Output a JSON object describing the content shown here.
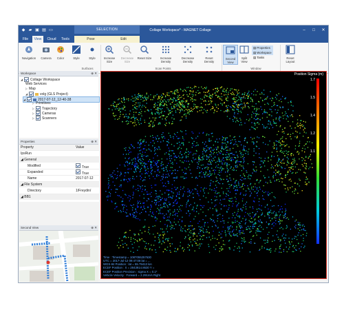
{
  "title_bar": {
    "context_tab_title": "SELECTION",
    "app_title": "Collage Workspace* - MAGNET Collage",
    "minimize_glyph": "–",
    "maximize_glyph": "□",
    "close_glyph": "✕"
  },
  "tabs": [
    "File",
    "View",
    "Cloud",
    "Tools",
    "Pose",
    "Edit"
  ],
  "active_tab": "View",
  "ribbon": {
    "buttons": {
      "navigation": "Navigation",
      "camera": "Camera",
      "color": "Color",
      "style1": "Style",
      "style2": "Style",
      "increase_size": "Increase Size",
      "decrease_size": "Decrease Size",
      "reset_size": "Reset Size",
      "increase_density": "Increase Density",
      "decrease_density": "Decrease Density",
      "reset_density": "Reset Density",
      "second_view": "Second View",
      "split_view": "Split View",
      "properties": "Properties",
      "workspace": "Workspace",
      "tasks": "Tasks",
      "reset_layout": "Reset Layout"
    },
    "groups": {
      "surfaces": "Surfaces",
      "scan_points": "Scan Points",
      "window": "Window"
    }
  },
  "workspace_panel": {
    "title": "Workspace",
    "items": {
      "root": "Collage Workspace",
      "web_services": "Web Services",
      "map": "Map",
      "project": "volg (GLS Project)",
      "run": "2017-07-12_12-40-38",
      "primitives": "Primitives",
      "trajectory": "Trajectory",
      "cameras": "Cameras",
      "scanners": "Scanners"
    }
  },
  "properties_panel": {
    "title": "Properties",
    "header_property": "Property",
    "header_value": "Value",
    "object": "IpsRun",
    "cat_general": "General",
    "rows": [
      {
        "k": "Modified",
        "v": "True"
      },
      {
        "k": "Expanded",
        "v": "True"
      },
      {
        "k": "Name",
        "v": "2017-07-12"
      }
    ],
    "cat_fs": "File System",
    "dir_k": "Directory",
    "dir_v": "1/Freydin/",
    "cat_bb": "BB1"
  },
  "second_view": {
    "title": "Second View"
  },
  "viewer": {
    "colorbar_title": "Position Sigma (m)",
    "colorbar_labels": [
      "1.7",
      "1.5",
      "1.4",
      "1.2",
      "1.1"
    ],
    "info_lines": [
      "Time : Timestamp = 1087055257630",
      "UTC = 2017-Jul-12 09:47:08 lat = ...",
      "WGS-84 Position : lat = 55.79413 lon",
      "ECEF Position : X = 2843914.8630 Y =",
      "ECEF Position Precision : sigma X = 0.1*",
      "Vehicle Velocity : Forward = 2.291m/s Right"
    ]
  },
  "colors": {
    "title_blue": "#2b579a",
    "selection_red": "#e03a2f",
    "info_text": "#5ea6ff"
  }
}
